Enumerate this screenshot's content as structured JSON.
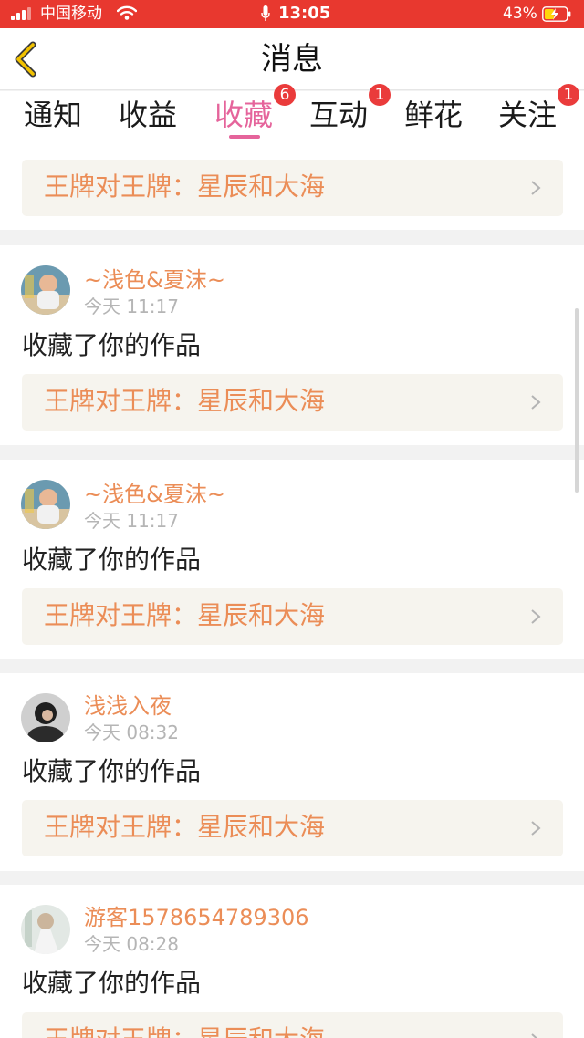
{
  "status_bar": {
    "carrier": "中国移动",
    "time": "13:05",
    "battery": "43%",
    "battery_level": 0.43,
    "bg_color": "#e8382f"
  },
  "header": {
    "title": "消息",
    "back_icon": "chevron-left-icon",
    "back_icon_color": "#f2c200"
  },
  "tabs": [
    {
      "label": "通知",
      "badge": ""
    },
    {
      "label": "收益",
      "badge": ""
    },
    {
      "label": "收藏",
      "badge": "6",
      "active": true
    },
    {
      "label": "互动",
      "badge": "1"
    },
    {
      "label": "鲜花",
      "badge": ""
    },
    {
      "label": "关注",
      "badge": "1"
    }
  ],
  "colors": {
    "accent": "#e5649b",
    "username": "#eb8d57",
    "badge": "#ea3b3b",
    "link_bg": "#f6f4ee"
  },
  "feed": {
    "top_link": {
      "title": "王牌对王牌：星辰和大海"
    },
    "items": [
      {
        "username": "~浅色&夏沫~",
        "time": "今天 11:17",
        "action": "收藏了你的作品",
        "work_title": "王牌对王牌：星辰和大海"
      },
      {
        "username": "~浅色&夏沫~",
        "time": "今天 11:17",
        "action": "收藏了你的作品",
        "work_title": "王牌对王牌：星辰和大海"
      },
      {
        "username": "浅浅入夜",
        "time": "今天 08:32",
        "action": "收藏了你的作品",
        "work_title": "王牌对王牌：星辰和大海"
      },
      {
        "username": "游客1578654789306",
        "time": "今天 08:28",
        "action": "收藏了你的作品",
        "work_title": "王牌对王牌：星辰和大海"
      }
    ]
  }
}
